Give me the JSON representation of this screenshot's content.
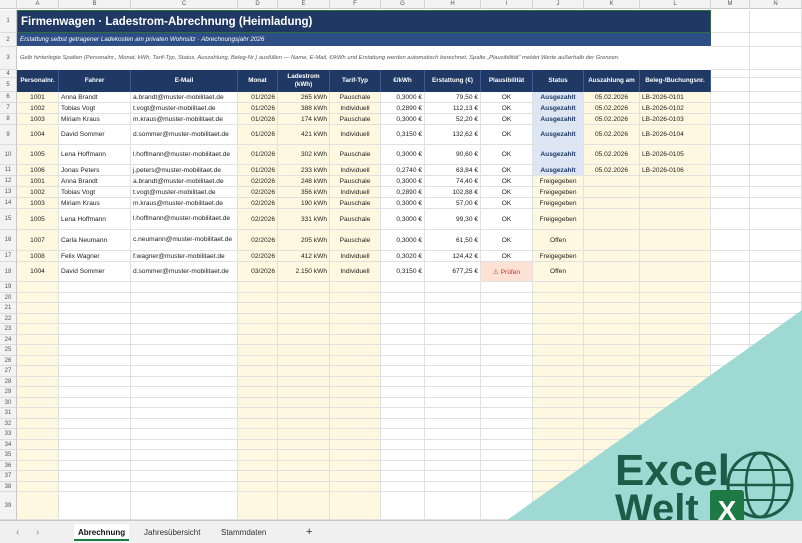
{
  "sheet": {
    "title": "Firmenwagen · Ladestrom-Abrechnung (Heimladung)",
    "subtitle": "Erstattung selbst getragener Ladekosten am privaten Wohnsitz  ·  Abrechnungsjahr 2026",
    "note": "Gelb hinterlegte Spalten (Personalnr., Monat, kWh, Tarif-Typ, Status, Auszahlung, Beleg-Nr.) ausfüllen — Name, E-Mail, €/kWh und Erstattung werden automatisch berechnet.  Spalte „Plausibilität“ meldet Werte außerhalb der Grenzen."
  },
  "columns": [
    "A",
    "B",
    "C",
    "D",
    "E",
    "F",
    "G",
    "H",
    "I",
    "J",
    "K",
    "L",
    "M",
    "N"
  ],
  "row_numbers": [
    "1",
    "2",
    "3",
    "4",
    "5",
    "6",
    "7",
    "8",
    "9",
    "10",
    "11",
    "12",
    "13",
    "14",
    "15",
    "16",
    "17",
    "18",
    "19",
    "20",
    "21",
    "22",
    "23",
    "24",
    "25",
    "26",
    "27",
    "28",
    "29",
    "30",
    "31",
    "32",
    "33",
    "34",
    "35",
    "36",
    "37",
    "38",
    "39"
  ],
  "headers": {
    "personalnr": "Personalnr.",
    "fahrer": "Fahrer",
    "email": "E-Mail",
    "monat": "Monat",
    "ladestrom": "Ladestrom (kWh)",
    "tarif": "Tarif-Typ",
    "preis": "€/kWh",
    "erstattung": "Erstattung (€)",
    "plausi": "Plausibilität",
    "status": "Status",
    "auszahlung": "Auszahlung am",
    "beleg": "Beleg-/Buchungsnr."
  },
  "rows": [
    {
      "personalnr": "1001",
      "fahrer": "Anna Brandt",
      "email": "a.brandt@muster-mobilitaet.de",
      "monat": "01/2026",
      "kwh": "265 kWh",
      "tarif": "Pauschale",
      "preis": "0,3000 €",
      "erstattung": "79,50 €",
      "plausi": "OK",
      "status": "Ausgezahlt",
      "auszahlung": "05.02.2026",
      "beleg": "LB-2026-0101"
    },
    {
      "personalnr": "1002",
      "fahrer": "Tobias Vogt",
      "email": "t.vogt@muster-mobilitaet.de",
      "monat": "01/2026",
      "kwh": "388 kWh",
      "tarif": "Individuell",
      "preis": "0,2890 €",
      "erstattung": "112,13 €",
      "plausi": "OK",
      "status": "Ausgezahlt",
      "auszahlung": "05.02.2026",
      "beleg": "LB-2026-0102"
    },
    {
      "personalnr": "1003",
      "fahrer": "Miriam Kraus",
      "email": "m.kraus@muster-mobilitaet.de",
      "monat": "01/2026",
      "kwh": "174 kWh",
      "tarif": "Pauschale",
      "preis": "0,3000 €",
      "erstattung": "52,20 €",
      "plausi": "OK",
      "status": "Ausgezahlt",
      "auszahlung": "05.02.2026",
      "beleg": "LB-2026-0103"
    },
    {
      "personalnr": "1004",
      "fahrer": "David Sommer",
      "email": "d.sommer@muster-mobilitaet.de",
      "monat": "01/2026",
      "kwh": "421 kWh",
      "tarif": "Individuell",
      "preis": "0,3150 €",
      "erstattung": "132,62 €",
      "plausi": "OK",
      "status": "Ausgezahlt",
      "auszahlung": "05.02.2026",
      "beleg": "LB-2026-0104"
    },
    {
      "personalnr": "1005",
      "fahrer": "Lena Hoffmann",
      "email": "l.hoffmann@muster-mobilitaet.de",
      "monat": "01/2026",
      "kwh": "302 kWh",
      "tarif": "Pauschale",
      "preis": "0,3000 €",
      "erstattung": "90,60 €",
      "plausi": "OK",
      "status": "Ausgezahlt",
      "auszahlung": "05.02.2026",
      "beleg": "LB-2026-0105"
    },
    {
      "personalnr": "1006",
      "fahrer": "Jonas Peters",
      "email": "j.peters@muster-mobilitaet.de",
      "monat": "01/2026",
      "kwh": "233 kWh",
      "tarif": "Individuell",
      "preis": "0,2740 €",
      "erstattung": "63,84 €",
      "plausi": "OK",
      "status": "Ausgezahlt",
      "auszahlung": "05.02.2026",
      "beleg": "LB-2026-0106"
    },
    {
      "personalnr": "1001",
      "fahrer": "Anna Brandt",
      "email": "a.brandt@muster-mobilitaet.de",
      "monat": "02/2026",
      "kwh": "248 kWh",
      "tarif": "Pauschale",
      "preis": "0,3000 €",
      "erstattung": "74,40 €",
      "plausi": "OK",
      "status": "Freigegeben",
      "auszahlung": "",
      "beleg": ""
    },
    {
      "personalnr": "1002",
      "fahrer": "Tobias Vogt",
      "email": "t.vogt@muster-mobilitaet.de",
      "monat": "02/2026",
      "kwh": "356 kWh",
      "tarif": "Individuell",
      "preis": "0,2890 €",
      "erstattung": "102,88 €",
      "plausi": "OK",
      "status": "Freigegeben",
      "auszahlung": "",
      "beleg": ""
    },
    {
      "personalnr": "1003",
      "fahrer": "Miriam Kraus",
      "email": "m.kraus@muster-mobilitaet.de",
      "monat": "02/2026",
      "kwh": "190 kWh",
      "tarif": "Pauschale",
      "preis": "0,3000 €",
      "erstattung": "57,00 €",
      "plausi": "OK",
      "status": "Freigegeben",
      "auszahlung": "",
      "beleg": ""
    },
    {
      "personalnr": "1005",
      "fahrer": "Lena Hoffmann",
      "email": "l.hoffmann@muster-mobilitaet.de",
      "monat": "02/2026",
      "kwh": "331 kWh",
      "tarif": "Pauschale",
      "preis": "0,3000 €",
      "erstattung": "99,30 €",
      "plausi": "OK",
      "status": "Freigegeben",
      "auszahlung": "",
      "beleg": ""
    },
    {
      "personalnr": "1007",
      "fahrer": "Carla Neumann",
      "email": "c.neumann@muster-mobilitaet.de",
      "monat": "02/2026",
      "kwh": "205 kWh",
      "tarif": "Pauschale",
      "preis": "0,3000 €",
      "erstattung": "61,50 €",
      "plausi": "OK",
      "status": "Offen",
      "auszahlung": "",
      "beleg": ""
    },
    {
      "personalnr": "1008",
      "fahrer": "Felix Wagner",
      "email": "f.wagner@muster-mobilitaet.de",
      "monat": "02/2026",
      "kwh": "412 kWh",
      "tarif": "Individuell",
      "preis": "0,3020 €",
      "erstattung": "124,42 €",
      "plausi": "OK",
      "status": "Freigegeben",
      "auszahlung": "",
      "beleg": ""
    },
    {
      "personalnr": "1004",
      "fahrer": "David Sommer",
      "email": "d.sommer@muster-mobilitaet.de",
      "monat": "03/2026",
      "kwh": "2.150 kWh",
      "tarif": "Individuell",
      "preis": "0,3150 €",
      "erstattung": "677,25 €",
      "plausi": "⚠ Prüfen",
      "status": "Offen",
      "auszahlung": "",
      "beleg": ""
    }
  ],
  "tabs": {
    "abrechnung": "Abrechnung",
    "jahresuebersicht": "Jahresübersicht",
    "stammdaten": "Stammdaten",
    "add": "+",
    "prev": "‹",
    "next": "›"
  },
  "brand": {
    "line1": "Excel",
    "line2": "Welt",
    "badge": "X",
    "color_bg": "#9fd9d3",
    "color_text": "#1e5c47",
    "color_badge": "#1e7a45"
  },
  "colors": {
    "header_navy": "#203864",
    "input_yellow": "#fff8e0",
    "status_paid_bg": "#dce6f5",
    "warn_bg": "#fde1d4"
  }
}
